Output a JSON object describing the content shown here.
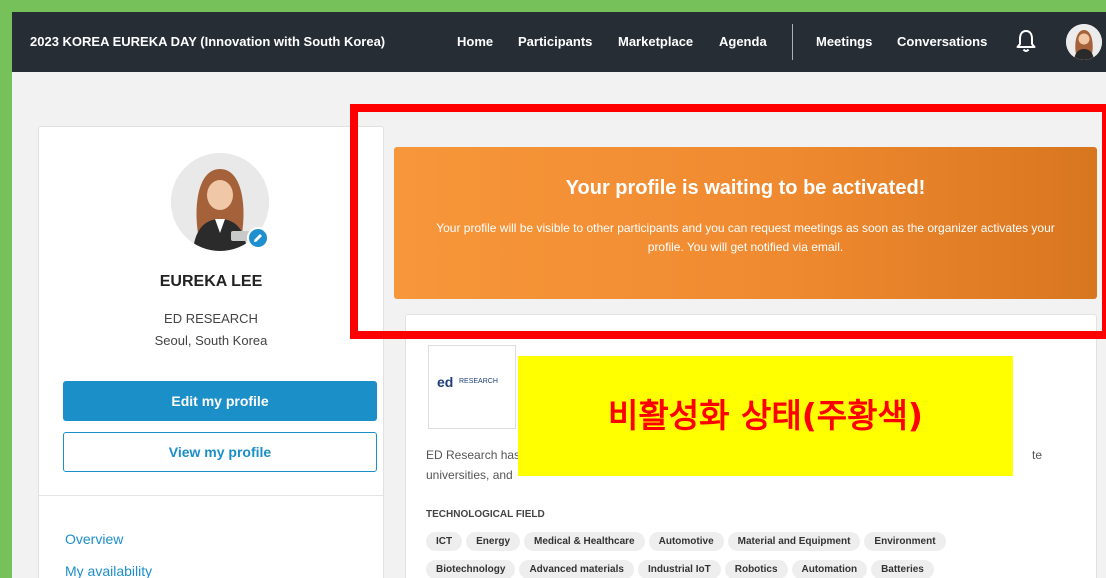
{
  "event_title": "2023 KOREA EUREKA DAY (Innovation with South Korea)",
  "nav": {
    "home": "Home",
    "participants": "Participants",
    "marketplace": "Marketplace",
    "agenda": "Agenda",
    "meetings": "Meetings",
    "conversations": "Conversations"
  },
  "icons": {
    "bell": "bell-icon",
    "avatar": "user-avatar",
    "edit": "pencil-icon"
  },
  "profile": {
    "name": "EUREKA LEE",
    "organization": "ED RESEARCH",
    "location": "Seoul, South Korea",
    "edit_button": "Edit my profile",
    "view_button": "View my profile"
  },
  "side_menu": [
    "Overview",
    "My availability"
  ],
  "banner": {
    "title": "Your profile is waiting to be activated!",
    "text": "Your profile will be visible to other participants and you can request meetings as soon as the organizer activates your profile. You will get notified via email."
  },
  "company": {
    "logo_text": "ed",
    "logo_sub": "RESEARCH",
    "description": "ED Research has",
    "description_tail": "te",
    "description_line2": "universities, and",
    "field_label": "TECHNOLOGICAL FIELD",
    "tags_row1": [
      "ICT",
      "Energy",
      "Medical & Healthcare",
      "Automotive",
      "Material and Equipment",
      "Environment"
    ],
    "tags_row2": [
      "Biotechnology",
      "Advanced materials",
      "Industrial IoT",
      "Robotics",
      "Automation",
      "Batteries"
    ]
  },
  "annotation": "비활성화 상태(주황색)",
  "colors": {
    "topbar": "#262d35",
    "accent": "#1b8fc8",
    "banner": "#f08a30",
    "highlight_border": "#ff0000",
    "annotation_bg": "#ffff00",
    "page_border": "#77c15b"
  }
}
